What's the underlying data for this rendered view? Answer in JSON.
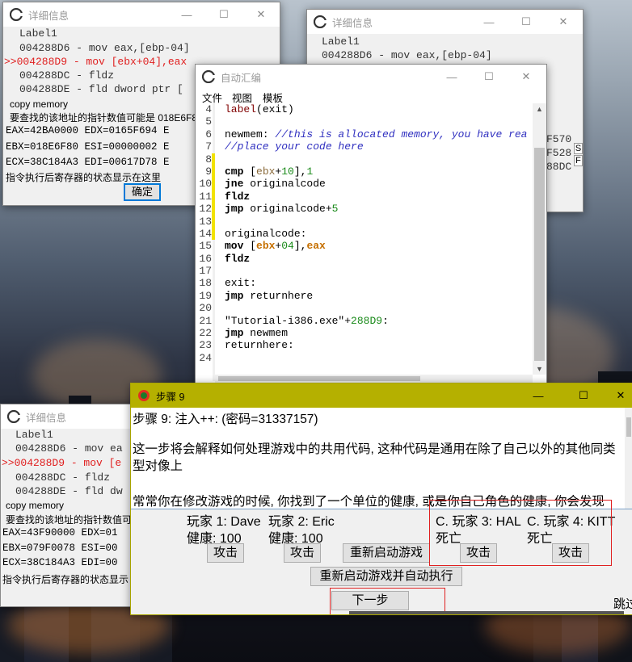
{
  "detail1": {
    "title": "详细信息",
    "label": "Label1",
    "lines": [
      {
        "text": "004288D6 - mov eax,[ebp-04]",
        "current": false
      },
      {
        "text": ">>004288D9 - mov [ebx+04],eax",
        "current": true
      },
      {
        "text": "004288DC - fldz",
        "current": false
      },
      {
        "text": "004288DE - fld dword ptr [",
        "current": false
      }
    ],
    "copy_memory": "copy memory",
    "hint": "要查找的该地址的指针数值可能是 018E6F8",
    "regs": [
      "EAX=42BA0000 EDX=0165F694 E",
      "EBX=018E6F80 ESI=00000002 E",
      "ECX=38C184A3 EDI=00617D78 E"
    ],
    "footer": "指令执行后寄存器的状态显示在这里",
    "ok_label": "确定"
  },
  "detail2": {
    "title": "详细信息",
    "label": "Label1",
    "lines": [
      {
        "text": "004288D6 - mov eax,[ebp-04]",
        "current": false
      }
    ],
    "right_fragments": [
      "F570",
      "F528",
      "88DC"
    ],
    "side_chars": [
      "S",
      "F"
    ]
  },
  "detail3": {
    "title": "详细信息",
    "label": "Label1",
    "lines": [
      {
        "text": "004288D6 - mov ea",
        "current": false
      },
      {
        "text": ">>004288D9 - mov [e",
        "current": true
      },
      {
        "text": "004288DC - fldz",
        "current": false
      },
      {
        "text": "004288DE - fld dw",
        "current": false
      }
    ],
    "copy_memory": "copy memory",
    "hint": "要查找的该地址的指针数值可",
    "regs": [
      "EAX=43F90000 EDX=01",
      "EBX=079F0078 ESI=00",
      "ECX=38C184A3 EDI=00"
    ],
    "footer": "指令执行后寄存器的状态显示"
  },
  "autoasm": {
    "title": "自动汇编",
    "menu": [
      "文件",
      "视图",
      "模板"
    ],
    "line_numbers": [
      "4",
      "5",
      "6",
      "7",
      "8",
      "9",
      "10",
      "11",
      "12",
      "13",
      "14",
      "15",
      "16",
      "17",
      "18",
      "19",
      "20",
      "21",
      "22",
      "23",
      "24"
    ],
    "code": [
      {
        "kind": "label",
        "a": "label",
        "b": "(exit)"
      },
      {
        "kind": "blank"
      },
      {
        "kind": "comment",
        "a": "newmem: ",
        "b": "//this is allocated memory, you have rea"
      },
      {
        "kind": "comment2",
        "b": "//place your code here"
      },
      {
        "kind": "blank"
      },
      {
        "kind": "cmp",
        "a": "cmp",
        "b": " [",
        "c": "ebx",
        "d": "+",
        "e": "10",
        "f": "],",
        "g": "1"
      },
      {
        "kind": "ins",
        "a": "jne",
        "b": " originalcode"
      },
      {
        "kind": "ins",
        "a": "fldz",
        "b": ""
      },
      {
        "kind": "jmpnum",
        "a": "jmp",
        "b": " originalcode+",
        "c": "5"
      },
      {
        "kind": "blank"
      },
      {
        "kind": "plain",
        "b": "originalcode:"
      },
      {
        "kind": "mov",
        "a": "mov",
        "b": " [",
        "c": "ebx",
        "d": "+",
        "e": "04",
        "f": "],",
        "g": "eax"
      },
      {
        "kind": "ins",
        "a": "fldz",
        "b": ""
      },
      {
        "kind": "blank"
      },
      {
        "kind": "plain",
        "b": "exit:"
      },
      {
        "kind": "ins",
        "a": "jmp",
        "b": " returnhere"
      },
      {
        "kind": "blank"
      },
      {
        "kind": "str",
        "a": "\"Tutorial-i386.exe\"",
        "b": "+",
        "c": "288D9",
        "d": ":"
      },
      {
        "kind": "ins",
        "a": "jmp",
        "b": " newmem"
      },
      {
        "kind": "plain",
        "b": "returnhere:"
      },
      {
        "kind": "blank"
      }
    ]
  },
  "step9": {
    "title": "步骤 9",
    "heading": "步骤 9: 注入++: (密码=31337157)",
    "para1": "这一步将会解释如何处理游戏中的共用代码, 这种代码是通用在除了自己以外的其他同类型对像上",
    "para2": "常常你在修改游戏的时候, 你找到了一个单位的健康, 或是你自己角色的健康, 你会发现",
    "players": [
      {
        "name": "玩家 1: Dave",
        "status": "健康: 100",
        "button": "攻击"
      },
      {
        "name": "玩家 2: Eric",
        "status": "健康: 100",
        "button": "攻击"
      },
      {
        "name": "C. 玩家 3: HAL",
        "status": "死亡",
        "button": "攻击"
      },
      {
        "name": "C. 玩家 4: KITT",
        "status": "死亡",
        "button": "攻击"
      }
    ],
    "restart_label": "重新启动游戏",
    "restart_auto_label": "重新启动游戏并自动执行",
    "next_label": "下一步",
    "skip_label": "跳过",
    "highlight_color": "#e02020"
  }
}
